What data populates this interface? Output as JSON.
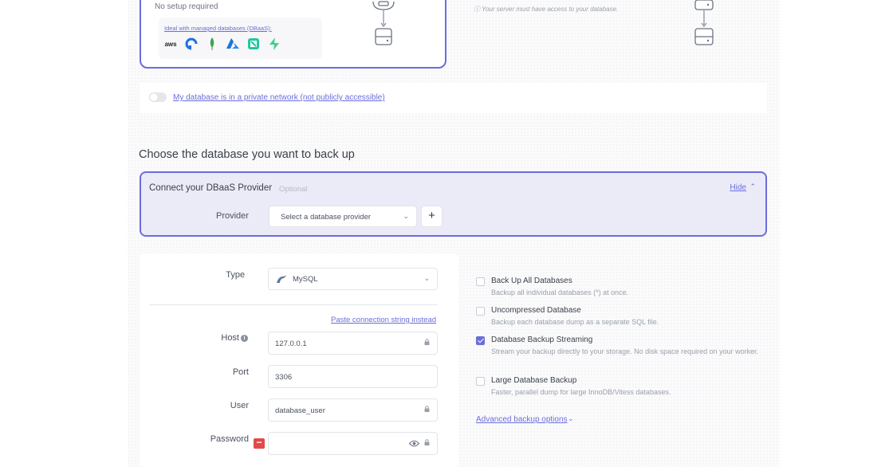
{
  "top_card": {
    "no_setup": "No setup required",
    "dbaas_link": "Ideal with managed databases (DBaaS):",
    "logos": [
      "aws-logo",
      "digitalocean-logo",
      "mongodb-logo",
      "azure-logo",
      "neon-logo",
      "supabase-logo"
    ],
    "aws_text": "aws"
  },
  "right_note": "Your server must have access to your database.",
  "private_network": {
    "label": "My database is in a private network (not publicly accessible)",
    "enabled": false
  },
  "section_title": "Choose the database you want to back up",
  "provider_card": {
    "title": "Connect your DBaaS Provider",
    "optional": "Optional",
    "hide_label": "Hide",
    "provider_label": "Provider",
    "provider_placeholder": "Select a database provider",
    "add_symbol": "+"
  },
  "form": {
    "type_label": "Type",
    "type_value": "MySQL",
    "paste_link": "Paste connection string instead",
    "host_label": "Host",
    "host_value": "127.0.0.1",
    "port_label": "Port",
    "port_value": "3306",
    "user_label": "User",
    "user_value": "database_user",
    "password_label": "Password",
    "password_value": "",
    "password_badge": "•••"
  },
  "options": [
    {
      "title": "Back Up All Databases",
      "desc": "Backup all individual databases (*) at once.",
      "checked": false
    },
    {
      "title": "Uncompressed Database",
      "desc": "Backup each database dump as a separate SQL file.",
      "checked": false
    },
    {
      "title": "Database Backup Streaming",
      "desc": "Stream your backup directly to your storage. No disk space required on your worker.",
      "checked": true
    },
    {
      "title": "Large Database Backup",
      "desc": "Faster, parallel dump for large InnoDB/Vitess databases.",
      "checked": false
    }
  ],
  "advanced_link": "Advanced backup options",
  "colors": {
    "accent": "#6b6ddb",
    "provider_bg": "#ebeaf7"
  }
}
